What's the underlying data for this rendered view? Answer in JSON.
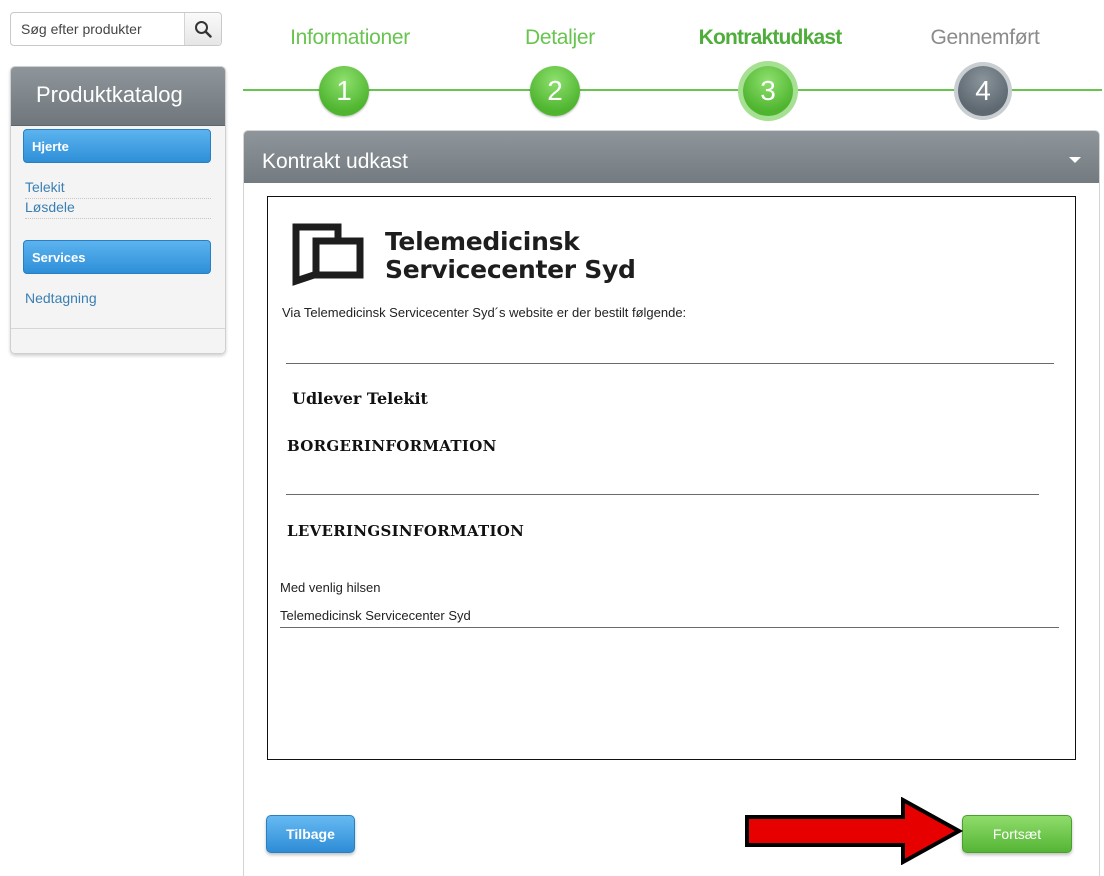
{
  "search": {
    "placeholder": "Søg efter produkter",
    "icon": "search-icon"
  },
  "sidebar": {
    "title": "Produktkatalog",
    "categories": [
      {
        "label": "Hjerte",
        "items": [
          "Telekit",
          "Løsdele"
        ]
      },
      {
        "label": "Services",
        "items": [
          "Nedtagning"
        ]
      }
    ]
  },
  "steps": [
    {
      "label": "Informationer",
      "number": "1",
      "state": "done"
    },
    {
      "label": "Detaljer",
      "number": "2",
      "state": "done"
    },
    {
      "label": "Kontraktudkast",
      "number": "3",
      "state": "active"
    },
    {
      "label": "Gennemført",
      "number": "4",
      "state": "pending"
    }
  ],
  "panel": {
    "title": "Kontrakt udkast",
    "doc": {
      "logo_line1": "Telemedicinsk",
      "logo_line2": "Servicecenter Syd",
      "intro": "Via Telemedicinsk Servicecenter Syd´s website er der bestilt følgende:",
      "heading": "Udlever Telekit",
      "section1": "BORGERINFORMATION",
      "section2": "LEVERINGSINFORMATION",
      "closing": "Med venlig hilsen",
      "signature": "Telemedicinsk Servicecenter Syd"
    },
    "back_label": "Tilbage",
    "next_label": "Fortsæt"
  },
  "colors": {
    "accent_blue": "#2e8fd8",
    "accent_green": "#55b535",
    "header_grey": "#737b80",
    "arrow_red": "#e60000"
  }
}
